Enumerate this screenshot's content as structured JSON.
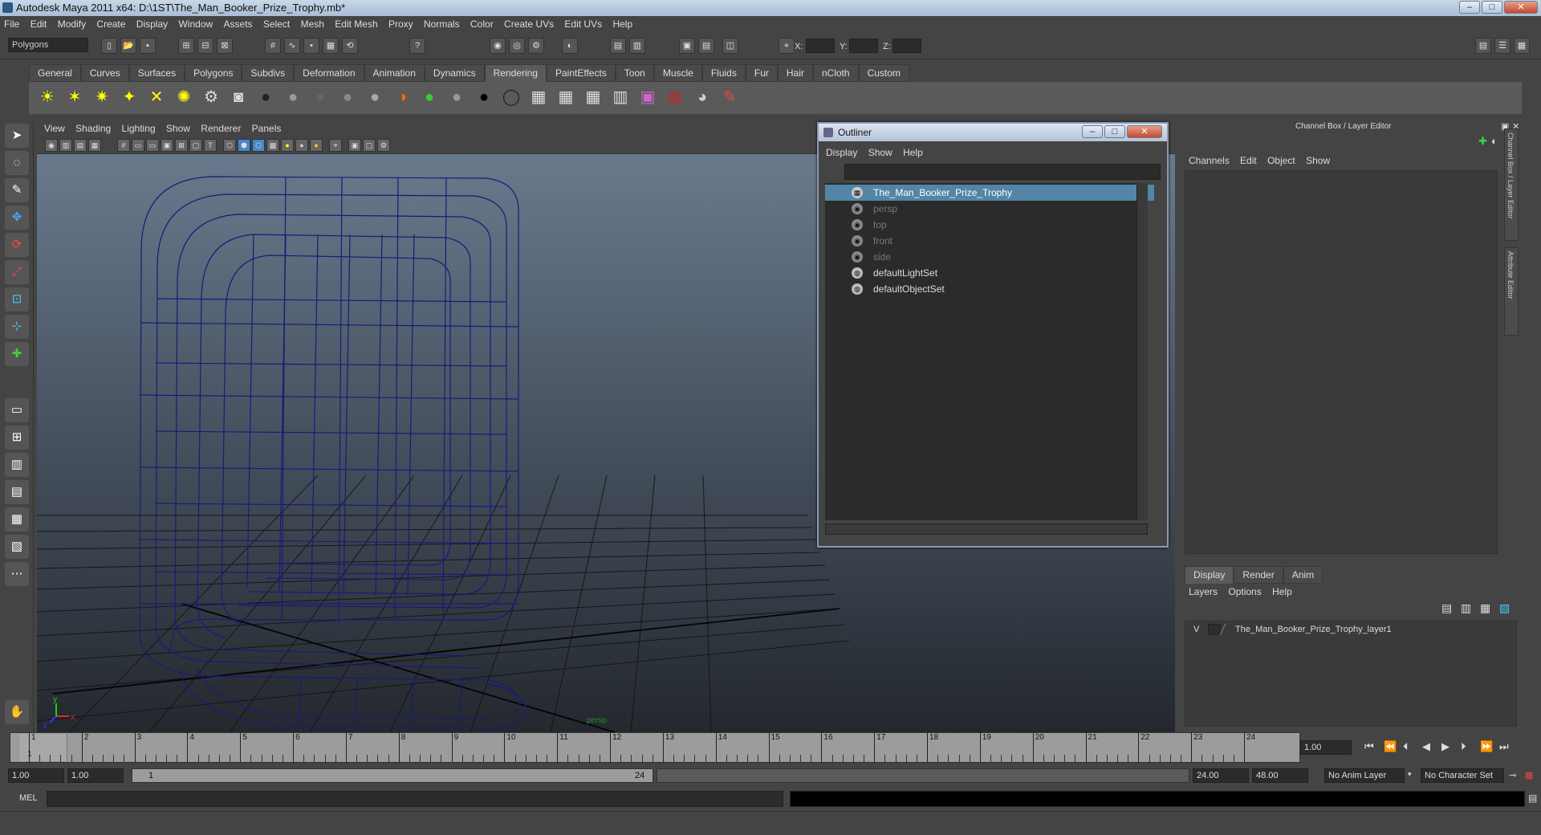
{
  "window": {
    "title": "Autodesk Maya 2011 x64: D:\\1ST\\The_Man_Booker_Prize_Trophy.mb*",
    "minimize": "–",
    "maximize": "□",
    "close": "✕"
  },
  "menubar": {
    "items": [
      "File",
      "Edit",
      "Modify",
      "Create",
      "Display",
      "Window",
      "Assets",
      "Select",
      "Mesh",
      "Edit Mesh",
      "Proxy",
      "Normals",
      "Color",
      "Create UVs",
      "Edit UVs",
      "Help"
    ]
  },
  "statusline": {
    "mode": "Polygons",
    "x_label": "X:",
    "y_label": "Y:",
    "z_label": "Z:"
  },
  "shelf": {
    "tabs": [
      "General",
      "Curves",
      "Surfaces",
      "Polygons",
      "Subdivs",
      "Deformation",
      "Animation",
      "Dynamics",
      "Rendering",
      "PaintEffects",
      "Toon",
      "Muscle",
      "Fluids",
      "Fur",
      "Hair",
      "nCloth",
      "Custom"
    ],
    "active_tab": "Rendering"
  },
  "viewport": {
    "menus": [
      "View",
      "Shading",
      "Lighting",
      "Show",
      "Renderer",
      "Panels"
    ],
    "camera_label": "persp",
    "axis_x": "x",
    "axis_y": "y",
    "axis_z": "z",
    "wire_color": "#1a1a7a"
  },
  "outliner": {
    "title": "Outliner",
    "menus": [
      "Display",
      "Show",
      "Help"
    ],
    "items": [
      {
        "label": "The_Man_Booker_Prize_Trophy",
        "selected": true,
        "dim": false
      },
      {
        "label": "persp",
        "selected": false,
        "dim": true
      },
      {
        "label": "top",
        "selected": false,
        "dim": true
      },
      {
        "label": "front",
        "selected": false,
        "dim": true
      },
      {
        "label": "side",
        "selected": false,
        "dim": true
      },
      {
        "label": "defaultLightSet",
        "selected": false,
        "dim": false
      },
      {
        "label": "defaultObjectSet",
        "selected": false,
        "dim": false
      }
    ]
  },
  "channelbox": {
    "title": "Channel Box / Layer Editor",
    "menus": [
      "Channels",
      "Edit",
      "Object",
      "Show"
    ],
    "side_tab_1": "Channel Box / Layer Editor",
    "side_tab_2": "Attribute Editor"
  },
  "layers": {
    "tabs": [
      "Display",
      "Render",
      "Anim"
    ],
    "menus": [
      "Layers",
      "Options",
      "Help"
    ],
    "layer_visibility": "V",
    "layer_name": "The_Man_Booker_Prize_Trophy_layer1"
  },
  "timeline": {
    "ticks": [
      "1",
      "2",
      "3",
      "4",
      "5",
      "6",
      "7",
      "8",
      "9",
      "10",
      "11",
      "12",
      "13",
      "14",
      "15",
      "16",
      "17",
      "18",
      "19",
      "20",
      "21",
      "22",
      "23",
      "24"
    ],
    "current_frame": "1",
    "current_time_field": "1.00"
  },
  "range": {
    "start": "1.00",
    "inner_start": "1.00",
    "slider_start": "1",
    "slider_end": "24",
    "inner_end": "24.00",
    "end": "48.00",
    "anim_layer": "No Anim Layer",
    "character_set": "No Character Set"
  },
  "cmdline": {
    "label": "MEL"
  },
  "colors": {
    "selection": "#5285a6",
    "panel": "#444444",
    "accent_title": "#b4c3d6"
  }
}
